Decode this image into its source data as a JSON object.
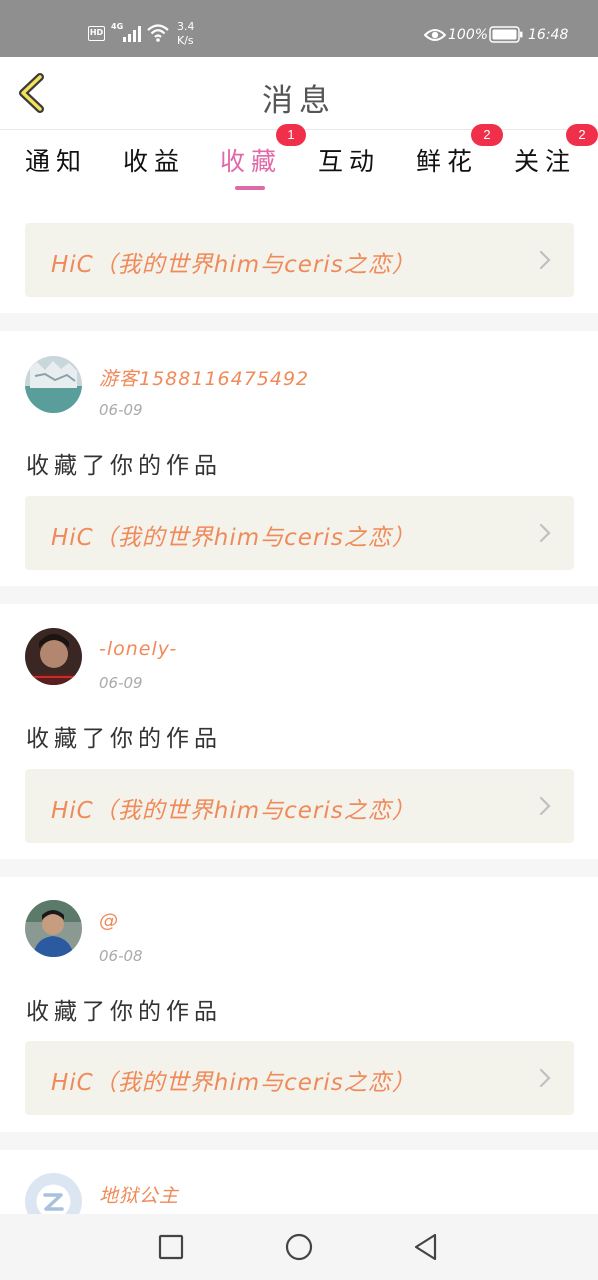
{
  "status_bar": {
    "hd": "HD",
    "network": "4G",
    "speed_value": "3.4",
    "speed_unit": "K/s",
    "battery_percent": "100%",
    "time": "16:48"
  },
  "header": {
    "title": "消息",
    "back_icon": "chevron-left-icon"
  },
  "tabs": [
    {
      "label": "通知",
      "active": false,
      "badge": ""
    },
    {
      "label": "收益",
      "active": false,
      "badge": ""
    },
    {
      "label": "收藏",
      "active": true,
      "badge": "1"
    },
    {
      "label": "互动",
      "active": false,
      "badge": ""
    },
    {
      "label": "鲜花",
      "active": false,
      "badge": "2"
    },
    {
      "label": "关注",
      "active": false,
      "badge": "2"
    }
  ],
  "feed": {
    "first_card": {
      "work_title": "HiC（我的世界him与ceris之恋）"
    },
    "items": [
      {
        "username": "游客1588116475492",
        "date": "06-09",
        "action": "收藏了你的作品",
        "work_title": "HiC（我的世界him与ceris之恋）"
      },
      {
        "username": "-lonely-",
        "date": "06-09",
        "action": "收藏了你的作品",
        "work_title": "HiC（我的世界him与ceris之恋）"
      },
      {
        "username": "@",
        "date": "06-08",
        "action": "收藏了你的作品",
        "work_title": "HiC（我的世界him与ceris之恋）"
      },
      {
        "username": "地狱公主"
      }
    ]
  },
  "colors": {
    "accent_pink": "#e06aa8",
    "username_orange": "#f08a5a",
    "badge_red": "#f0304a",
    "work_box_bg": "#f3f3ec"
  },
  "nav_bar": {
    "icons": [
      "recent-apps-icon",
      "home-icon",
      "back-icon"
    ]
  }
}
